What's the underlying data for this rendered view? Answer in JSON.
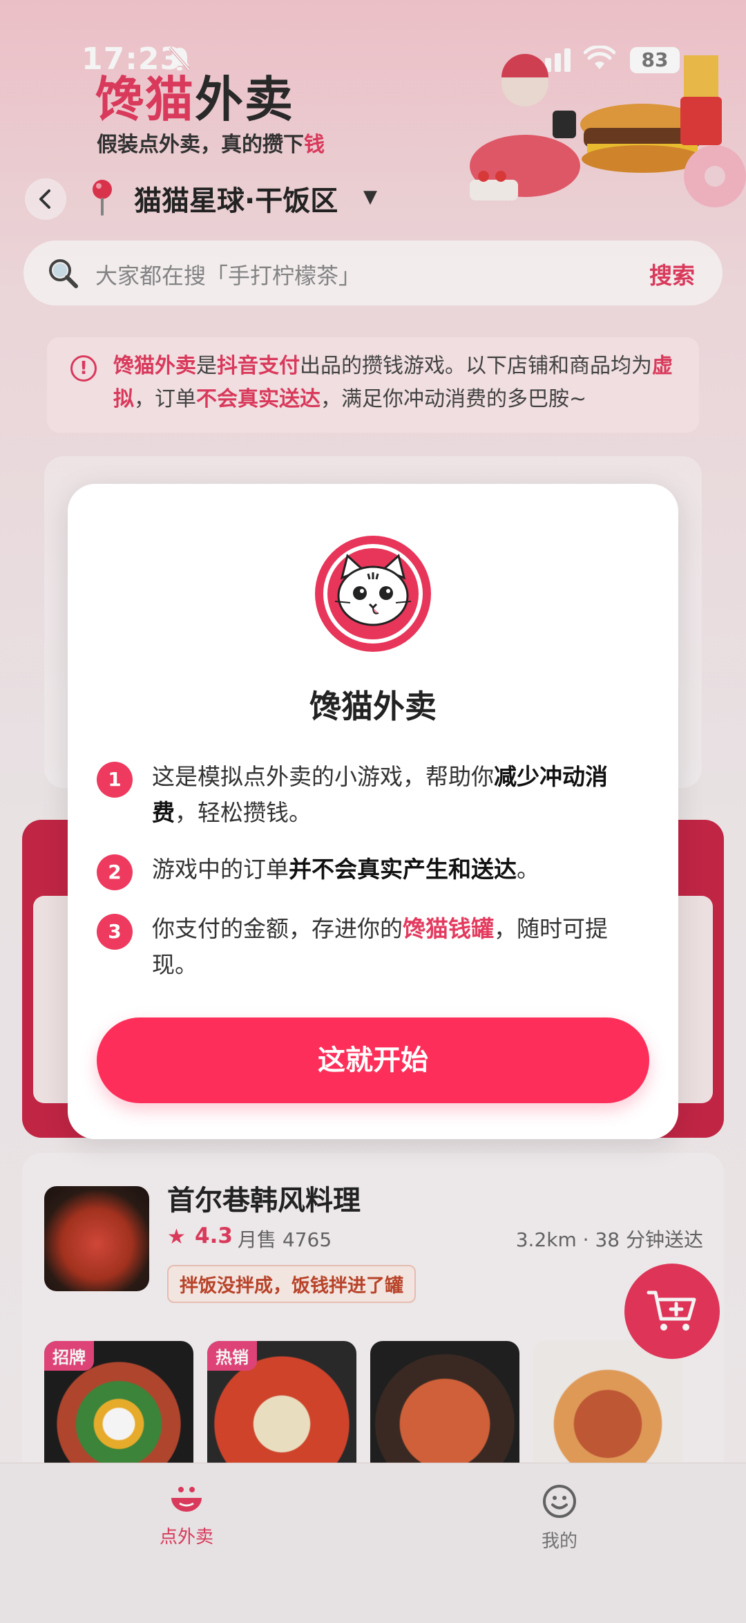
{
  "status_bar": {
    "time": "17:23",
    "battery": "83"
  },
  "brand": {
    "title_highlight": "馋猫",
    "title_rest": "外卖",
    "slogan_prefix": "假装点外卖，真的攒下",
    "slogan_highlight": "钱"
  },
  "location": {
    "text": "猫猫星球·干饭区",
    "caret": "▼"
  },
  "search": {
    "placeholder": "大家都在搜「手打柠檬茶」",
    "button_label": "搜索"
  },
  "notice": {
    "parts": [
      "馋猫外卖",
      "是",
      "抖音支付",
      "出品的攒钱游戏。以下店铺和商品均为",
      "虚拟",
      "，订单",
      "不会真实送达",
      "，满足你冲动消费的多巴胺~"
    ]
  },
  "shop": {
    "name": "首尔巷韩风料理",
    "rating": "4.3",
    "sales": "月售 4765",
    "distance": "3.2km · 38 分钟送达",
    "tag": "拌饭没拌成，饭钱拌进了罐",
    "dishes": [
      {
        "badge": "招牌"
      },
      {
        "badge": "热销"
      },
      {
        "badge": ""
      },
      {
        "badge": ""
      }
    ]
  },
  "tabs": [
    {
      "label": "点外卖",
      "icon": "bowl-icon",
      "active": true
    },
    {
      "label": "我的",
      "icon": "smiley-icon",
      "active": false
    }
  ],
  "modal": {
    "title": "馋猫外卖",
    "steps": [
      {
        "num": "1",
        "text_before": "这是模拟点外卖的小游戏，帮助你",
        "bold": "减少冲动消费",
        "text_after": "，轻松攒钱。"
      },
      {
        "num": "2",
        "text_before": "游戏中的订单",
        "bold": "并不会真实产生和送达",
        "text_after": "。"
      },
      {
        "num": "3",
        "text_before": "你支付的金额，存进你的",
        "pink": "馋猫钱罐",
        "text_after": "，随时可提现。"
      }
    ],
    "button_label": "这就开始"
  },
  "colors": {
    "accent": "#e33a5e",
    "button": "#fd2f5a",
    "banner": "#c92546"
  }
}
